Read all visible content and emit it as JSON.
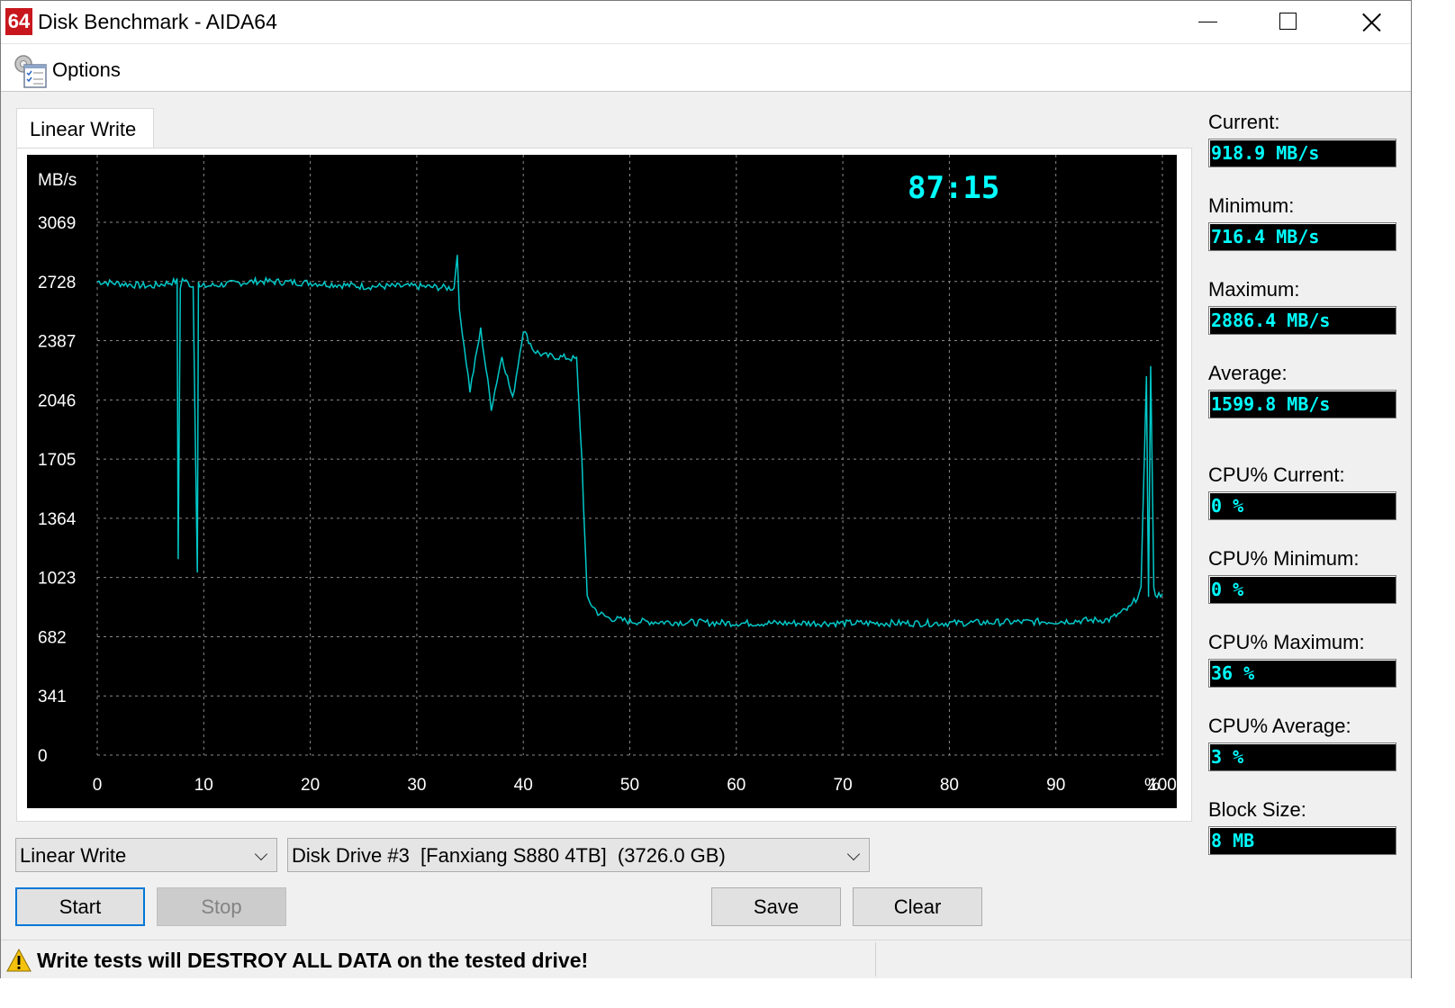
{
  "window": {
    "title": "Disk Benchmark - AIDA64",
    "icon_text": "64"
  },
  "menu": {
    "options_label": "Options"
  },
  "tab": {
    "label": "Linear Write"
  },
  "chart_data": {
    "type": "line",
    "ylabel": "MB/s",
    "y_ticks": [
      "3069",
      "2728",
      "2387",
      "2046",
      "1705",
      "1364",
      "1023",
      "682",
      "341",
      "0"
    ],
    "x_ticks": [
      "0",
      "10",
      "20",
      "30",
      "40",
      "50",
      "60",
      "70",
      "80",
      "90",
      "100"
    ],
    "x_unit": "%",
    "xlim": [
      0,
      100
    ],
    "ylim": [
      0,
      3069
    ],
    "grid": true,
    "timer": "87:15",
    "line_color": "#00c8c8",
    "series": [
      {
        "x": [
          0,
          5,
          7.5,
          7.6,
          7.8,
          8,
          9,
          9.4,
          9.5,
          9.6,
          10,
          15,
          20,
          25,
          30,
          33.5,
          33.8,
          34,
          34.3,
          35,
          36,
          37,
          38,
          39,
          40,
          41,
          42,
          44,
          45,
          45.5,
          46,
          47,
          48,
          50,
          60,
          70,
          80,
          90,
          95,
          97,
          98,
          98.5,
          98.7,
          98.9,
          99.2,
          99.5,
          100
        ],
        "y": [
          2728,
          2700,
          2730,
          1130,
          2700,
          2740,
          2700,
          1070,
          2730,
          2690,
          2700,
          2730,
          2720,
          2700,
          2700,
          2690,
          2900,
          2550,
          2430,
          2100,
          2450,
          2000,
          2300,
          2050,
          2450,
          2330,
          2300,
          2290,
          2280,
          1700,
          900,
          820,
          790,
          770,
          760,
          760,
          760,
          770,
          780,
          850,
          950,
          2200,
          900,
          2250,
          950,
          920,
          930
        ]
      }
    ]
  },
  "stats": {
    "current_label": "Current:",
    "current_value": "918.9 MB/s",
    "minimum_label": "Minimum:",
    "minimum_value": "716.4 MB/s",
    "maximum_label": "Maximum:",
    "maximum_value": "2886.4 MB/s",
    "average_label": "Average:",
    "average_value": "1599.8 MB/s",
    "cpu_current_label": "CPU% Current:",
    "cpu_current_value": "0 %",
    "cpu_minimum_label": "CPU% Minimum:",
    "cpu_minimum_value": "0 %",
    "cpu_maximum_label": "CPU% Maximum:",
    "cpu_maximum_value": "36 %",
    "cpu_average_label": "CPU% Average:",
    "cpu_average_value": "3 %",
    "block_size_label": "Block Size:",
    "block_size_value": "8 MB"
  },
  "controls": {
    "test_select": "Linear Write",
    "drive_select": "Disk Drive #3  [Fanxiang S880 4TB]  (3726.0 GB)",
    "start_label": "Start",
    "stop_label": "Stop",
    "save_label": "Save",
    "clear_label": "Clear"
  },
  "status": {
    "warning_text": "Write tests will DESTROY ALL DATA on the tested drive!"
  }
}
